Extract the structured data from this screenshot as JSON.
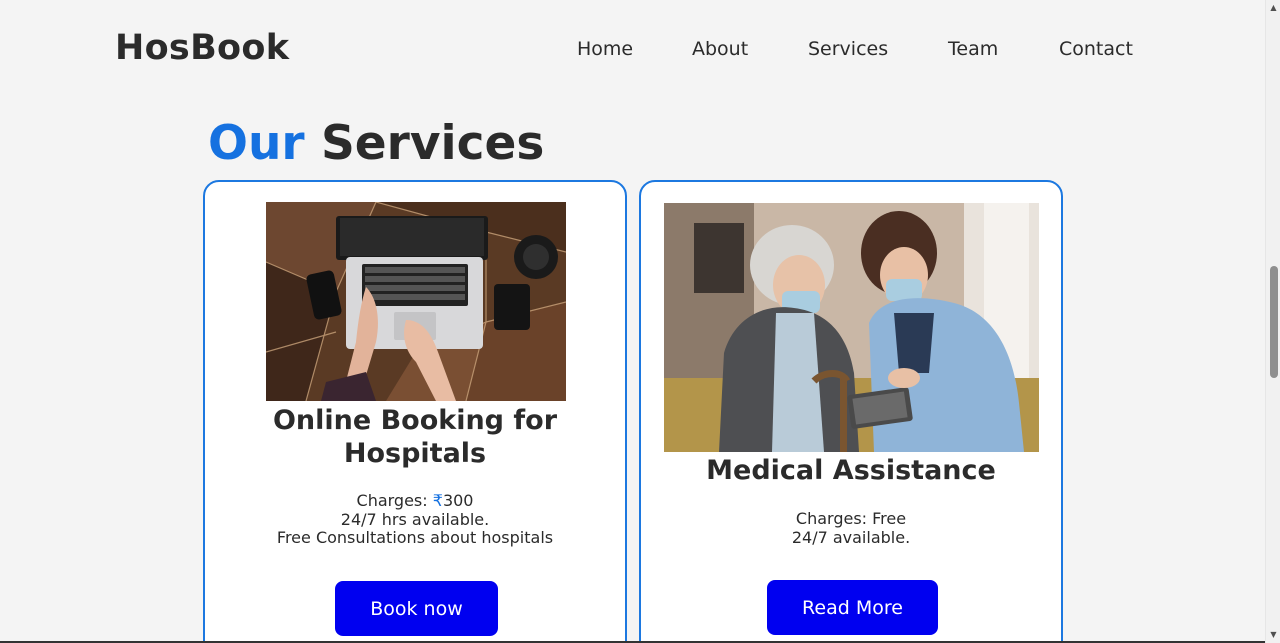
{
  "brand": {
    "name": "HosBook"
  },
  "nav": {
    "items": [
      "Home",
      "About",
      "Services",
      "Team",
      "Contact"
    ]
  },
  "section": {
    "title_accent": "Our",
    "title_rest": " Services"
  },
  "colors": {
    "accent": "#1571e0",
    "button": "#0000f0",
    "card_border": "#1c78e0",
    "background": "#f4f4f4"
  },
  "cards": [
    {
      "title": "Online Booking for Hospitals",
      "charges_label": "Charges: ",
      "charges_symbol": "₹",
      "charges_value": "300",
      "line2": "24/7 hrs available.",
      "line3": "Free Consultations about hospitals",
      "button": "Book now",
      "image_alt": "laptop-on-desk-photo"
    },
    {
      "title": "Medical Assistance",
      "charges_label": "Charges: ",
      "charges_value": "Free",
      "line2": "24/7 available.",
      "button": "Read More",
      "image_alt": "nurse-and-elderly-patient-photo"
    }
  ],
  "scrollbar": {
    "up_icon": "chevron-up-icon",
    "down_icon": "chevron-down-icon"
  }
}
